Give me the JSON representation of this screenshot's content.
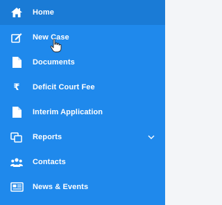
{
  "sidebar": {
    "items": [
      {
        "label": "Home",
        "icon": "home-icon"
      },
      {
        "label": "New Case",
        "icon": "edit-icon"
      },
      {
        "label": "Documents",
        "icon": "document-icon"
      },
      {
        "label": "Deficit Court Fee",
        "icon": "rupee-icon",
        "glyph": "₹"
      },
      {
        "label": "Interim Application",
        "icon": "document-icon"
      },
      {
        "label": "Reports",
        "icon": "reports-icon",
        "expand_icon": "chevron-down-icon"
      },
      {
        "label": "Contacts",
        "icon": "contacts-icon"
      },
      {
        "label": "News & Events",
        "icon": "news-icon"
      }
    ]
  },
  "colors": {
    "sidebar_bg": "#1f89ec",
    "text": "#ffffff",
    "active_bg": "#1a7bd6"
  },
  "cursor": "hand-pointer-icon"
}
